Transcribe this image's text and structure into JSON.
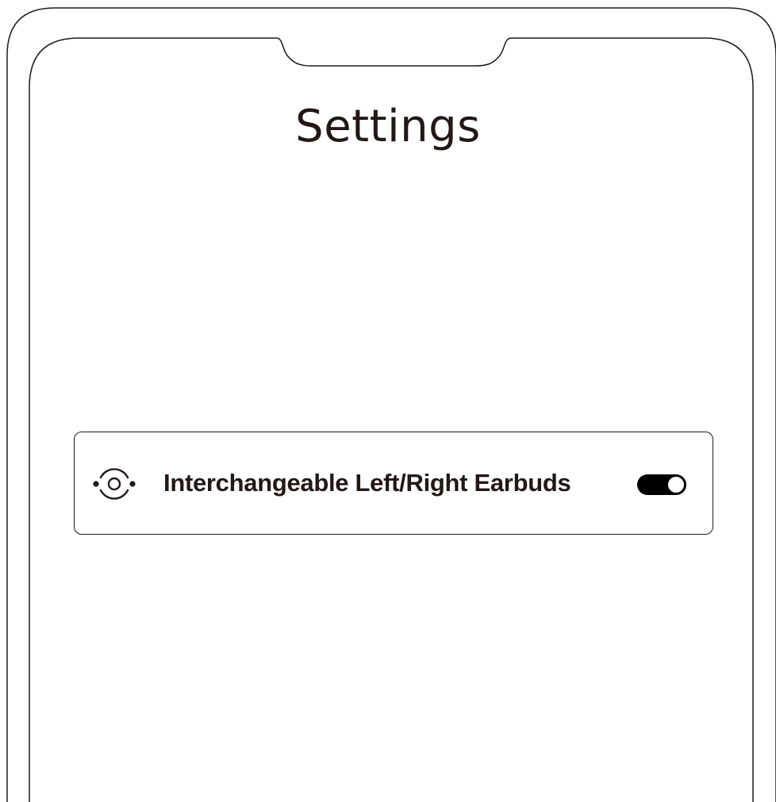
{
  "page": {
    "title": "Settings"
  },
  "settings": {
    "items": [
      {
        "icon": "swap-earbuds-icon",
        "label": "Interchangeable Left/Right Earbuds",
        "toggle_on": true
      }
    ]
  },
  "colors": {
    "text": "#231815",
    "toggle_on": "#000000",
    "background": "#ffffff"
  }
}
